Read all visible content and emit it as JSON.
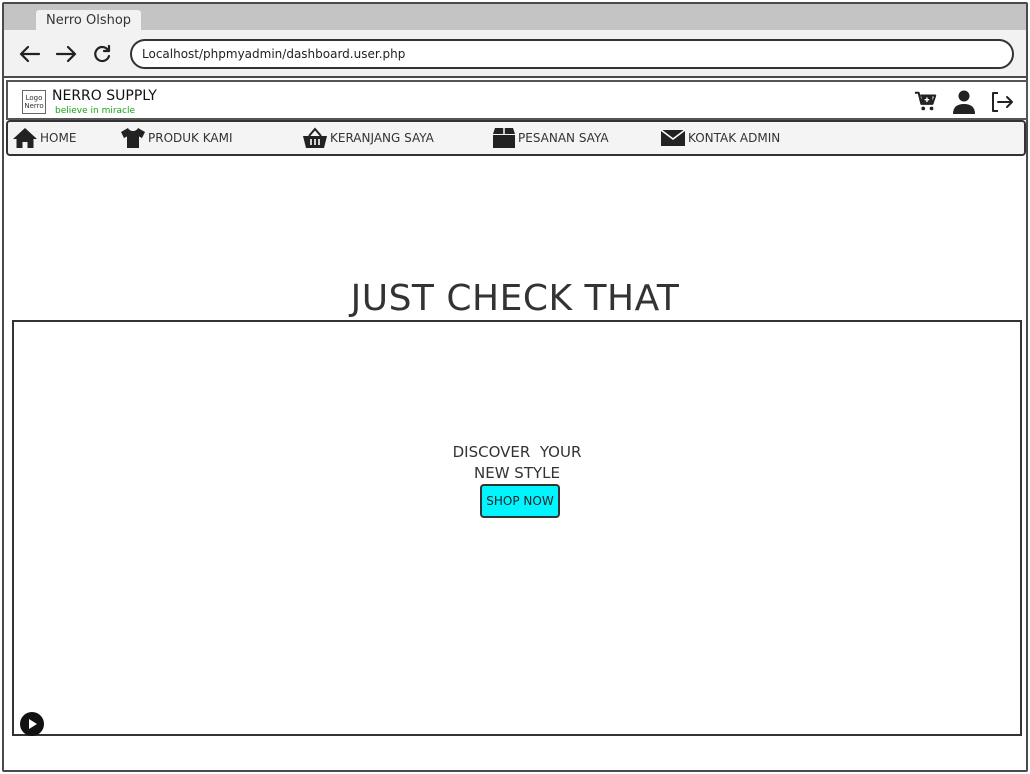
{
  "browser": {
    "tab_title": "Nerro Olshop",
    "url": "Localhost/phpmyadmin/dashboard.user.php"
  },
  "header": {
    "logo_text": "Logo Nerro",
    "brand": "NERRO SUPPLY",
    "tagline": "believe in miracle",
    "icons": [
      "cart-icon",
      "user-icon",
      "logout-icon"
    ]
  },
  "menu": {
    "items": [
      {
        "label": "HOME",
        "icon": "home-icon"
      },
      {
        "label": "PRODUK KAMI",
        "icon": "shirt-icon"
      },
      {
        "label": "KERANJANG SAYA",
        "icon": "basket-icon"
      },
      {
        "label": "PESANAN SAYA",
        "icon": "package-icon"
      },
      {
        "label": "KONTAK ADMIN",
        "icon": "mail-icon"
      }
    ]
  },
  "hero": {
    "title": "JUST CHECK THAT",
    "discover_line1": "DISCOVER  YOUR",
    "discover_line2": "NEW STYLE",
    "cta": "SHOP NOW"
  },
  "colors": {
    "cta_bg": "#00f5ff",
    "tagline": "#19a319"
  }
}
